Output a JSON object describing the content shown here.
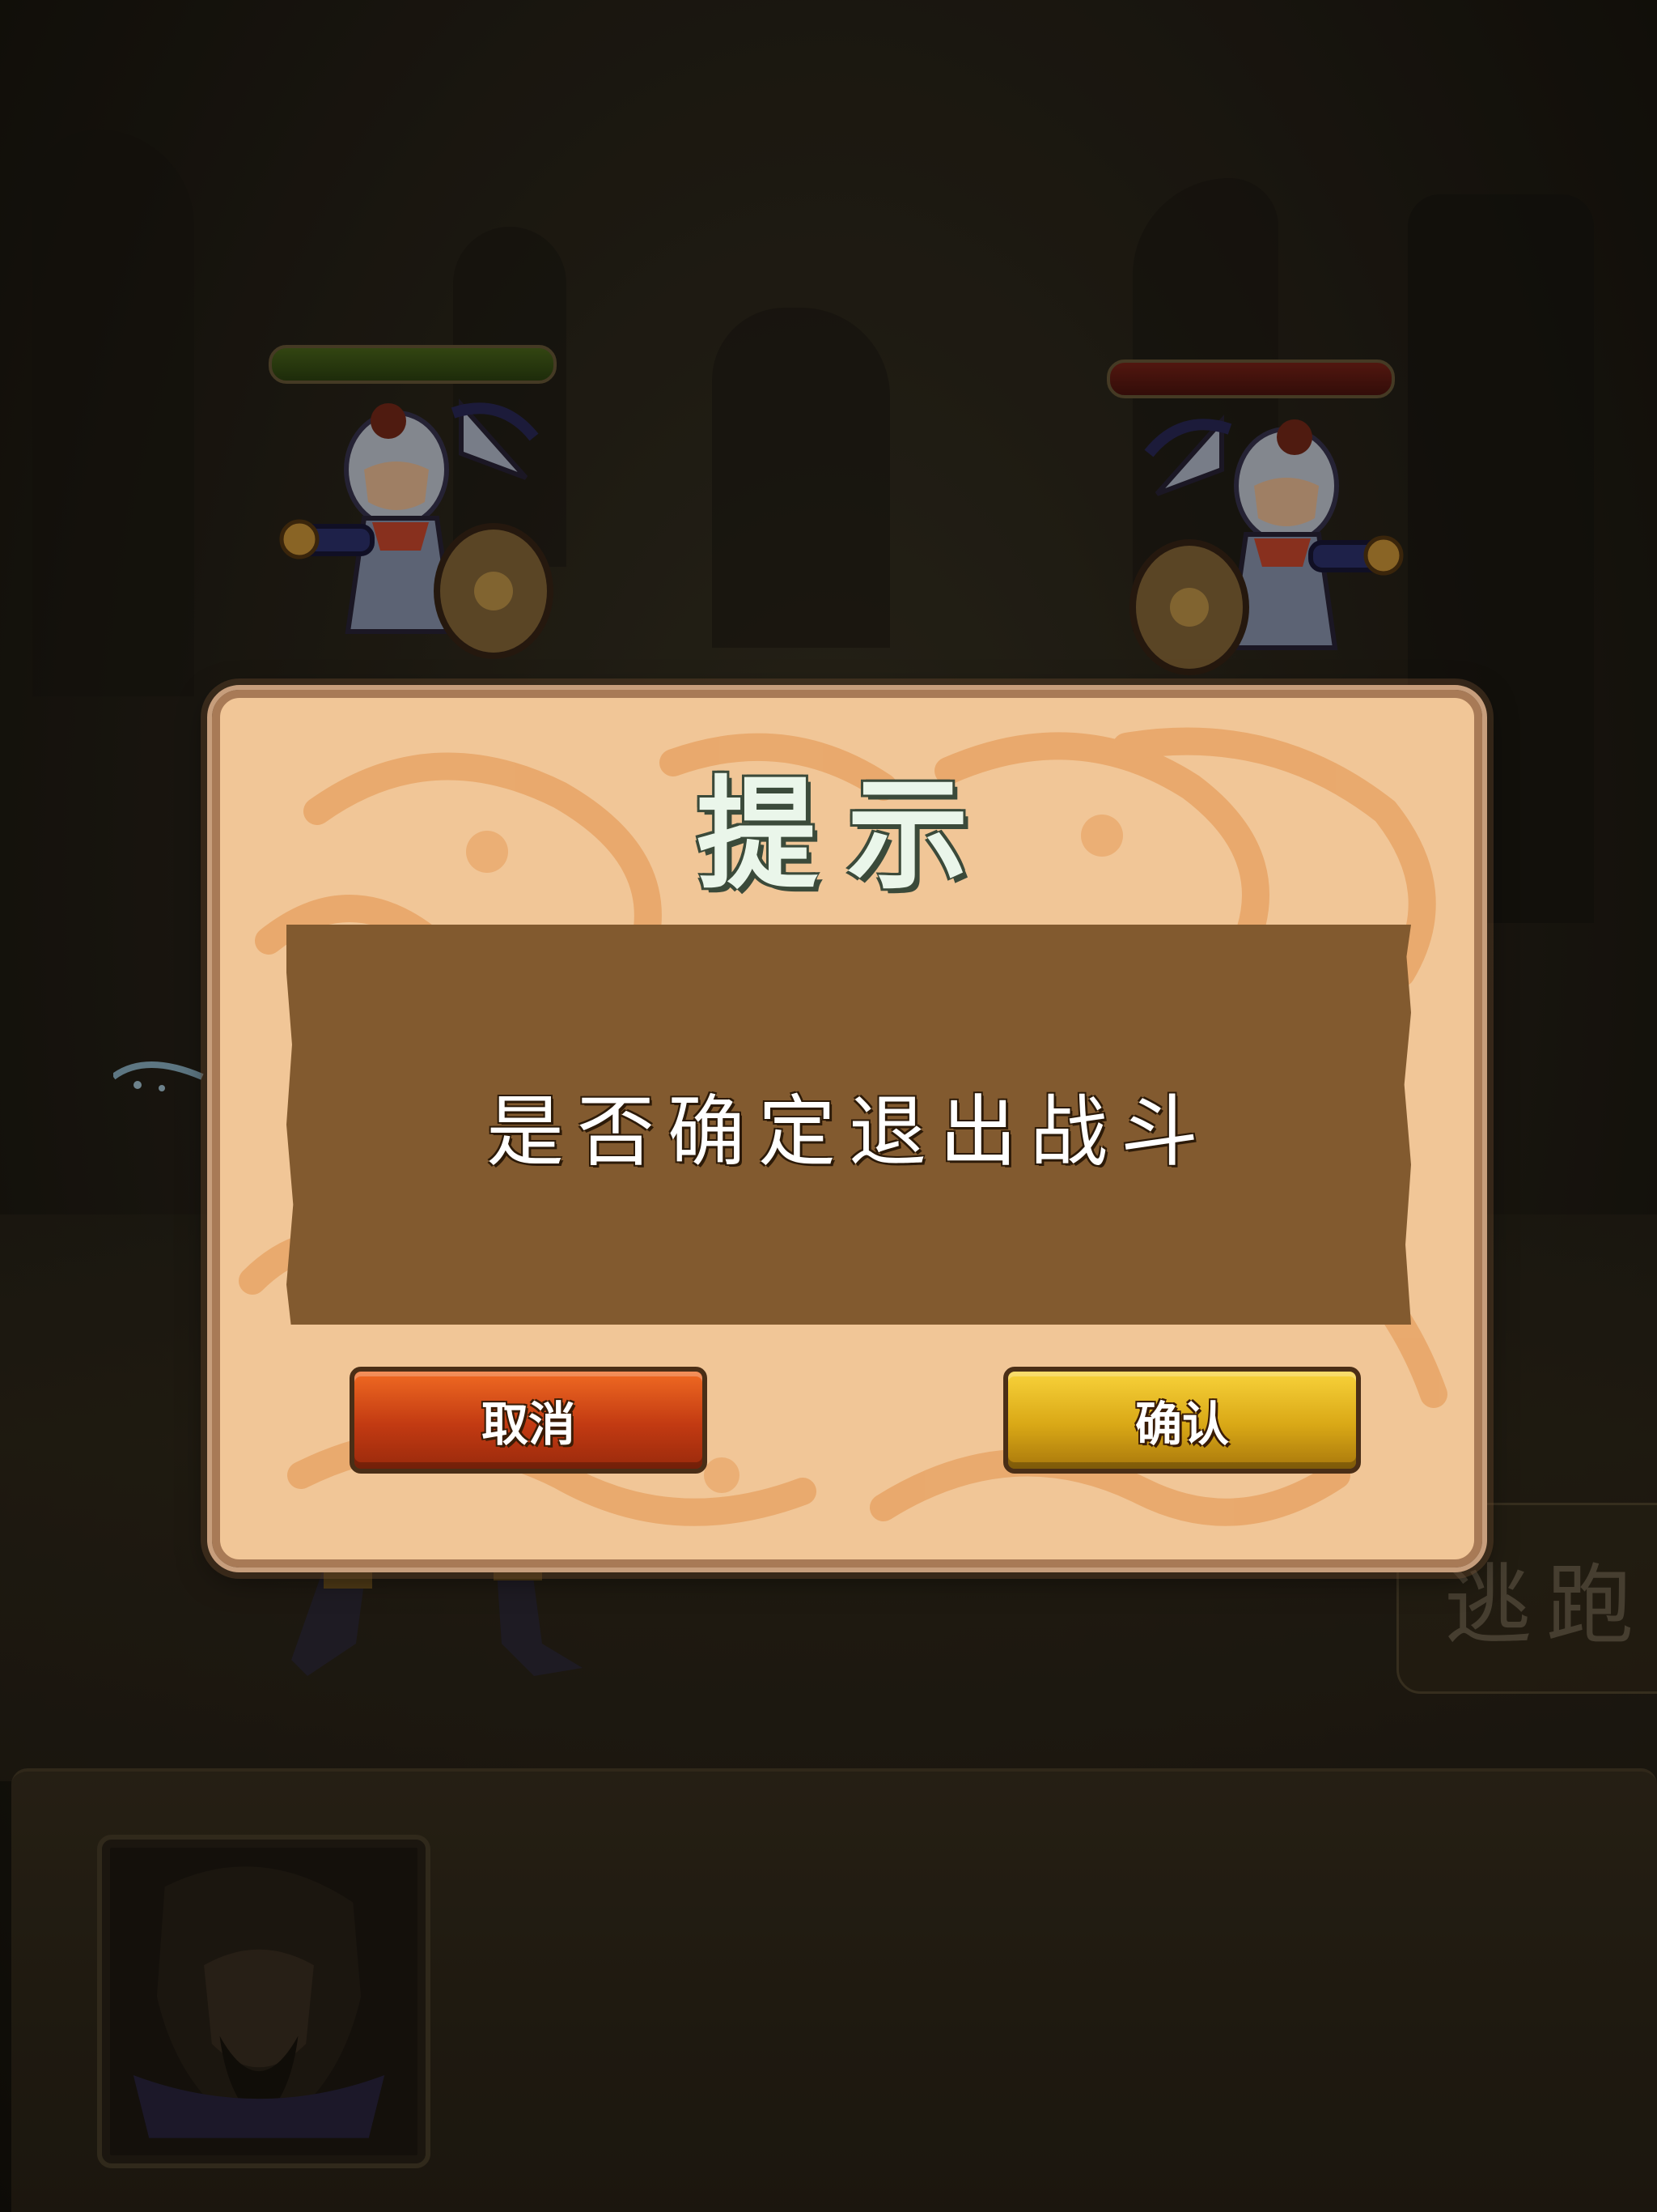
{
  "dialog": {
    "title": "提示",
    "message": "是否确定退出战斗",
    "cancel_label": "取消",
    "confirm_label": "确认"
  },
  "battle": {
    "flee_label": "逃跑",
    "ally_hp_color": "#3f5a17",
    "enemy_hp_color": "#6a1c12"
  },
  "icons": {
    "ally": "hero-sprite",
    "enemy": "hero-sprite",
    "portrait": "commander-portrait"
  }
}
